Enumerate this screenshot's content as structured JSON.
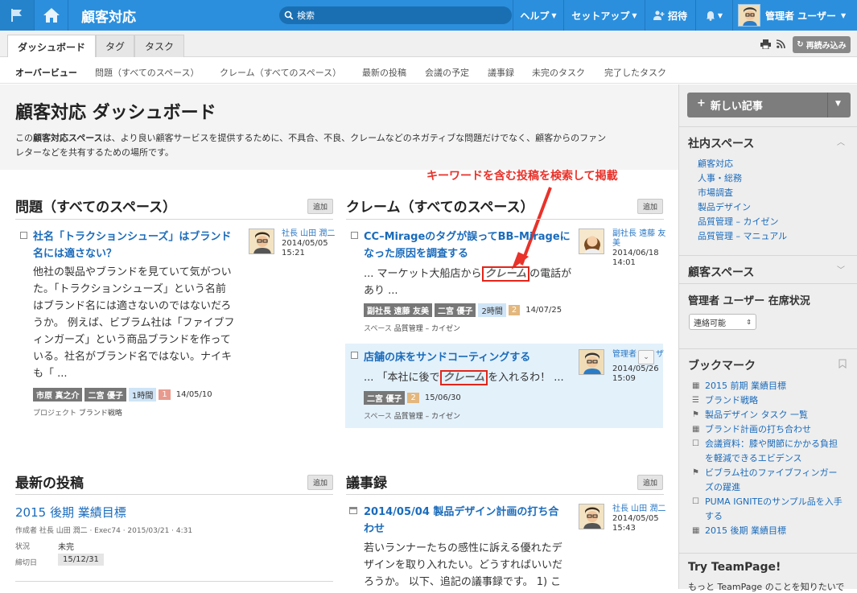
{
  "topbar": {
    "app_title": "顧客対応",
    "search_placeholder": "検索",
    "help": "ヘルプ",
    "setup": "セットアップ",
    "invite": "招待",
    "user": "管理者 ユーザー"
  },
  "tabs": [
    "ダッシュボード",
    "タグ",
    "タスク"
  ],
  "reload": "再読み込み",
  "subnav": [
    "オーバービュー",
    "問題（すべてのスペース）",
    "クレーム（すべてのスペース）",
    "最新の投稿",
    "会議の予定",
    "議事録",
    "未完のタスク",
    "完了したタスク"
  ],
  "hero": {
    "title": "顧客対応 ダッシュボード",
    "desc_pre": "この",
    "desc_bold": "顧客対応スペース",
    "desc_post1": "は、より良い顧客サービスを提供するために、不具合、不良、クレームなどのネガティブな問題だけでなく、顧客からのファン",
    "desc_post2": "レターなどを共有するための場所です。"
  },
  "annotation": "キーワードを含む投稿を検索して掲載",
  "add_label": "追加",
  "issues": {
    "title": "問題（すべてのスペース）",
    "post": {
      "title_l1": "社名「トラクションシューズ」はブランド",
      "title_l2": "名には適さない？",
      "author": "社長 山田 潤二",
      "date": "2014/05/05",
      "time": "15:21",
      "body": [
        "他社の製品やブランドを見ていて気がつい",
        "た。「トラクションシューズ」という名前",
        "はブランド名には適さないのではないだろ",
        "うか。 例えば、ビブラム社は「ファイブフ",
        "ィンガーズ」という商品ブランドを作って",
        "いる。社名がブランド名ではない。ナイキ",
        "も「 ..."
      ],
      "tags": [
        "市原 真之介",
        "二宮 優子",
        "1時間",
        "1",
        "14/05/10"
      ],
      "project_label": "プロジェクト",
      "project": "ブランド戦略"
    }
  },
  "claims": {
    "title": "クレーム（すべてのスペース）",
    "posts": [
      {
        "title_l1": "CC–Mirageのタグが誤ってBB–Mirageに",
        "title_l2": "なった原因を調査する",
        "author_l1": "副社長 遠藤 友",
        "author_l2": "美",
        "date": "2014/06/18",
        "time": "14:01",
        "body_pre": "... マーケット大船店から",
        "keyword": "クレーム",
        "body_post": "の電話が",
        "body_l2": "あり ...",
        "tags": [
          "副社長 遠藤 友美",
          "二宮 優子",
          "2時間",
          "2",
          "14/07/25"
        ],
        "space_label": "スペース",
        "space": "品質管理 – カイゼン"
      },
      {
        "title_l1": "店舗の床をサンドコーティングする",
        "author_l1": "管理者",
        "author_l2": "ザ",
        "date": "2014/05/26",
        "time": "15:09",
        "body_pre": "... 「本社に後で",
        "keyword": "クレーム",
        "body_post": "を入れるわ！ ...",
        "tags": [
          "二宮 優子",
          "2",
          "15/06/30"
        ],
        "space_label": "スペース",
        "space": "品質管理 – カイゼン"
      }
    ]
  },
  "latest": {
    "title": "最新の投稿",
    "post_title": "2015 後期 業績目標",
    "byline": "作成者 社長 山田 潤二 · Exec74 · 2015/03/21 · 4:31",
    "status_label": "状況",
    "status": "未完",
    "due_label": "締切日",
    "due": "15/12/31"
  },
  "minutes": {
    "title": "議事録",
    "post_title_l1": "2014/05/04 製品デザイン計画の打ち合",
    "post_title_l2": "わせ",
    "author": "社長 山田 潤二",
    "date": "2014/05/05",
    "time": "15:43",
    "body": [
      "若いランナーたちの感性に訴える優れたデ",
      "ザインを取り入れたい。どうすればいいだ",
      "ろうか。 以下、追記の議事録です。 1) こ"
    ]
  },
  "sidebar": {
    "new_post": "新しい記事",
    "internal_title": "社内スペース",
    "internal_links": [
      "顧客対応",
      "人事・総務",
      "市場調査",
      "製品デザイン",
      "品質管理 – カイゼン",
      "品質管理 – マニュアル"
    ],
    "customer_title": "顧客スペース",
    "presence_title": "管理者 ユーザー 在席状況",
    "presence_value": "連絡可能",
    "bookmarks_title": "ブックマーク",
    "bookmarks": [
      {
        "icon": "calendar-icon",
        "text": "2015 前期 業績目標"
      },
      {
        "icon": "list-icon",
        "text": "ブランド戦略"
      },
      {
        "icon": "bookmark-icon",
        "text": "製品デザイン タスク 一覧"
      },
      {
        "icon": "calendar-icon",
        "text": "ブランド計画の打ち合わせ"
      },
      {
        "icon": "checkbox-icon",
        "text": "会議資料：膝や関節にかかる負担"
      },
      {
        "icon": "none",
        "text": "を軽減できるエビデンス"
      },
      {
        "icon": "bookmark-icon",
        "text": "ビブラム社のファイブフィンガー"
      },
      {
        "icon": "none",
        "text": "ズの躍進"
      },
      {
        "icon": "checkbox-icon",
        "text": "PUMA IGNITEのサンプル品を入手"
      },
      {
        "icon": "none",
        "text": "する"
      },
      {
        "icon": "calendar-icon",
        "text": "2015 後期 業績目標"
      }
    ],
    "try_title": "Try TeamPage!",
    "try_text": "もっと TeamPage のことを知りたいで"
  }
}
